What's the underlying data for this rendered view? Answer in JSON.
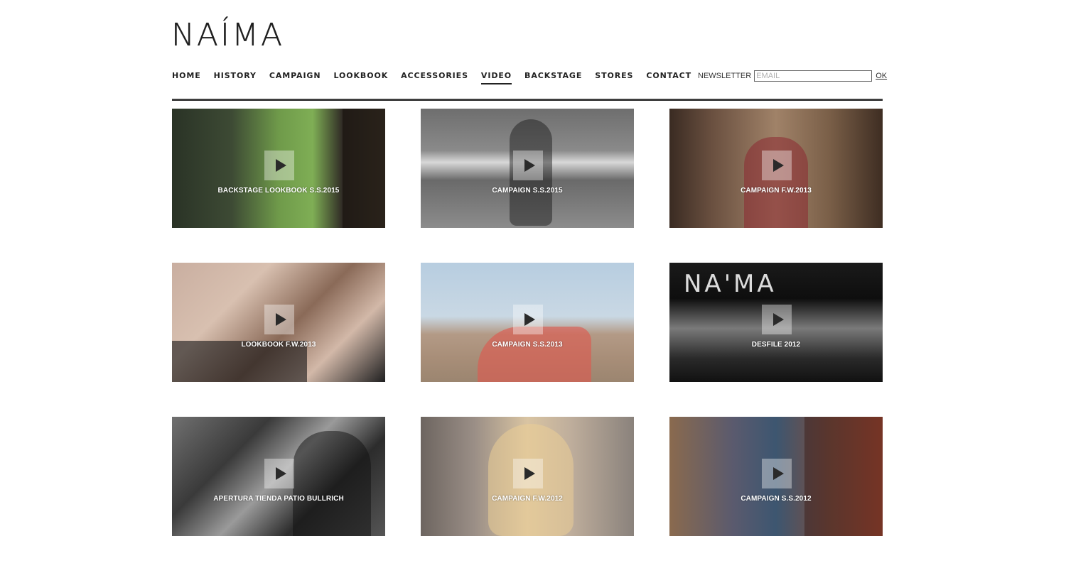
{
  "brand": {
    "logo_text": "NAÍMA"
  },
  "nav": {
    "items": [
      {
        "label": "HOME",
        "active": false
      },
      {
        "label": "HISTORY",
        "active": false
      },
      {
        "label": "CAMPAIGN",
        "active": false
      },
      {
        "label": "LOOKBOOK",
        "active": false
      },
      {
        "label": "ACCESSORIES",
        "active": false
      },
      {
        "label": "VIDEO",
        "active": true
      },
      {
        "label": "BACKSTAGE",
        "active": false
      },
      {
        "label": "STORES",
        "active": false
      },
      {
        "label": "CONTACT",
        "active": false
      }
    ]
  },
  "newsletter": {
    "label": "NEWSLETTER",
    "placeholder": "EMAIL",
    "value": "",
    "submit_label": "OK"
  },
  "videos": [
    {
      "title": "BACKSTAGE LOOKBOOK S.S.2015",
      "icon": "play-icon"
    },
    {
      "title": "CAMPAIGN S.S.2015",
      "icon": "play-icon"
    },
    {
      "title": "CAMPAIGN F.W.2013",
      "icon": "play-icon"
    },
    {
      "title": "LOOKBOOK F.W.2013",
      "icon": "play-icon"
    },
    {
      "title": "CAMPAIGN S.S.2013",
      "icon": "play-icon"
    },
    {
      "title": "DESFILE 2012",
      "icon": "play-icon"
    },
    {
      "title": "APERTURA TIENDA PATIO BULLRICH",
      "icon": "play-icon"
    },
    {
      "title": "CAMPAIGN F.W.2012",
      "icon": "play-icon"
    },
    {
      "title": "CAMPAIGN S.S.2012",
      "icon": "play-icon"
    }
  ],
  "thumb_overlay_text": {
    "desfile": "NA'MA"
  },
  "colors": {
    "text": "#1a1a1a",
    "divider": "#333333",
    "play_button_bg": "rgba(255,255,255,0.38)"
  }
}
